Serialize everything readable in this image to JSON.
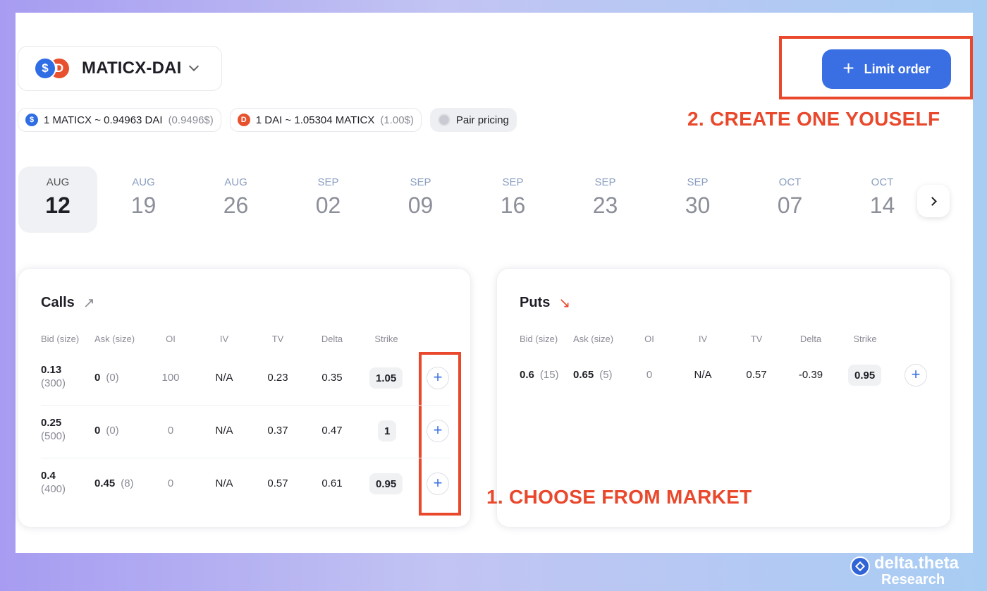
{
  "pair": {
    "name": "MATICX-DAI"
  },
  "prices": [
    {
      "icon": "maticx-token-icon",
      "text": "1 MATICX ~ 0.94963 DAI",
      "usd": "(0.9496$)"
    },
    {
      "icon": "dai-token-icon",
      "text": "1 DAI ~ 1.05304 MATICX",
      "usd": "(1.00$)"
    }
  ],
  "pair_pricing_label": "Pair pricing",
  "limit_order": {
    "label": "Limit order"
  },
  "annotations": {
    "create": "2. CREATE ONE YOUSELF",
    "choose": "1. CHOOSE FROM MARKET"
  },
  "dates": [
    {
      "mon": "AUG",
      "day": "12",
      "selected": true
    },
    {
      "mon": "AUG",
      "day": "19"
    },
    {
      "mon": "AUG",
      "day": "26"
    },
    {
      "mon": "SEP",
      "day": "02"
    },
    {
      "mon": "SEP",
      "day": "09"
    },
    {
      "mon": "SEP",
      "day": "16"
    },
    {
      "mon": "SEP",
      "day": "23"
    },
    {
      "mon": "SEP",
      "day": "30"
    },
    {
      "mon": "OCT",
      "day": "07"
    },
    {
      "mon": "OCT",
      "day": "14"
    }
  ],
  "columns": [
    "Bid (size)",
    "Ask (size)",
    "OI",
    "IV",
    "TV",
    "Delta",
    "Strike"
  ],
  "calls": {
    "title": "Calls",
    "rows": [
      {
        "bid": "0.13",
        "bid_size": "(300)",
        "ask": "0",
        "ask_size": "(0)",
        "oi": "100",
        "iv": "N/A",
        "tv": "0.23",
        "delta": "0.35",
        "strike": "1.05"
      },
      {
        "bid": "0.25",
        "bid_size": "(500)",
        "ask": "0",
        "ask_size": "(0)",
        "oi": "0",
        "iv": "N/A",
        "tv": "0.37",
        "delta": "0.47",
        "strike": "1"
      },
      {
        "bid": "0.4",
        "bid_size": "(400)",
        "ask": "0.45",
        "ask_size": "(8)",
        "oi": "0",
        "iv": "N/A",
        "tv": "0.57",
        "delta": "0.61",
        "strike": "0.95"
      }
    ]
  },
  "puts": {
    "title": "Puts",
    "rows": [
      {
        "bid": "0.6",
        "bid_size": "(15)",
        "ask": "0.65",
        "ask_size": "(5)",
        "oi": "0",
        "iv": "N/A",
        "tv": "0.57",
        "delta": "-0.39",
        "strike": "0.95"
      }
    ]
  },
  "brand": {
    "line1": "delta.theta",
    "line2": "Research"
  },
  "colors": {
    "accent": "#3a6fe4",
    "annotation": "#e9482c"
  }
}
